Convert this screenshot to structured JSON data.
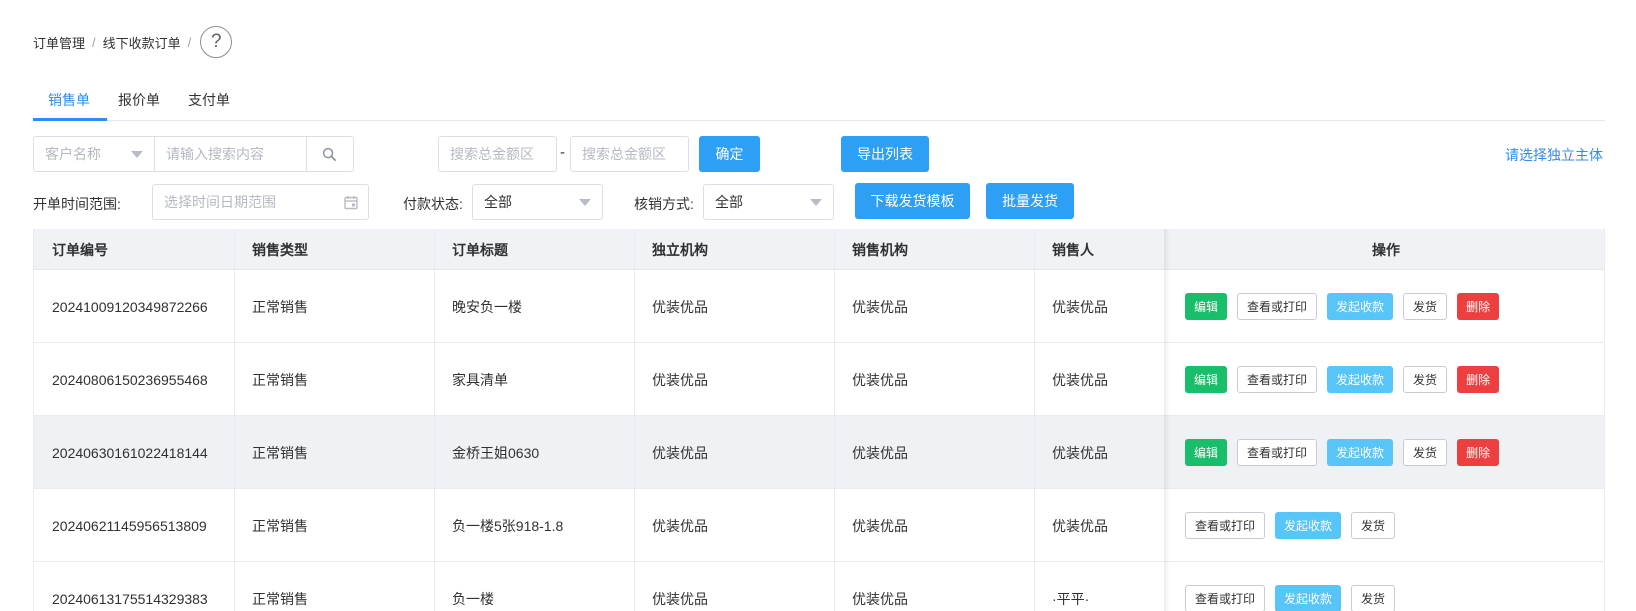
{
  "breadcrumb": {
    "item1": "订单管理",
    "sep": "/",
    "item2": "线下收款订单",
    "help": "?"
  },
  "tabs": [
    {
      "label": "销售单",
      "active": true
    },
    {
      "label": "报价单",
      "active": false
    },
    {
      "label": "支付单",
      "active": false
    }
  ],
  "filters": {
    "customer_select_placeholder": "客户名称",
    "search_placeholder": "请输入搜索内容",
    "amount_min_placeholder": "搜索总金额区",
    "amount_max_placeholder": "搜索总金额区",
    "amount_dash": "-",
    "confirm_label": "确定",
    "export_label": "导出列表",
    "select_entity_link": "请选择独立主体",
    "date_label": "开单时间范围:",
    "date_placeholder": "选择时间日期范围",
    "pay_status_label": "付款状态:",
    "pay_status_value": "全部",
    "writeoff_label": "核销方式:",
    "writeoff_value": "全部",
    "download_template_label": "下载发货模板",
    "batch_ship_label": "批量发货"
  },
  "table": {
    "headers": [
      "订单编号",
      "销售类型",
      "订单标题",
      "独立机构",
      "销售机构",
      "销售人",
      "操作"
    ],
    "rows": [
      {
        "id": "2024100912034987226‌6",
        "type": "正常销售",
        "title": "晚安负一楼",
        "org": "优装优品",
        "sales_org": "优装优品",
        "seller": "优装优品",
        "actions": [
          "编辑",
          "查看或打印",
          "发起收款",
          "发货",
          "删除"
        ]
      }
    ]
  },
  "rows": [
    {
      "id": "20241009120349872266",
      "type": "正常销售",
      "title": "晚安负一楼",
      "org": "优装优品",
      "sales_org": "优装优品",
      "seller": "优装优品"
    },
    {
      "id": "20240806150236955468",
      "type": "正常销售",
      "title": "家具清单",
      "org": "优装优品",
      "sales_org": "优装优品",
      "seller": "优装优品"
    },
    {
      "id": "20240630161022418144",
      "type": "正常销售",
      "title": "金桥王姐0630",
      "org": "优装优品",
      "sales_org": "优装优品",
      "seller": "优装优品"
    },
    {
      "id": "20240621145956513809",
      "type": "正常销售",
      "title": "负一楼5张918-1.8",
      "org": "优装优品",
      "sales_org": "优装优品",
      "seller": "优装优品"
    },
    {
      "id": "20240613175514329383",
      "type": "正常销售",
      "title": "负一楼",
      "org": "优装优品",
      "sales_org": "优装优品",
      "seller": "·平平·"
    }
  ],
  "actions": {
    "edit": "编辑",
    "view": "查看或打印",
    "collect": "发起收款",
    "ship": "发货",
    "delete": "删除"
  },
  "colors": {
    "primary": "#2d9ff5",
    "success": "#19be6b",
    "danger": "#ed3f3f",
    "info": "#57c5f7"
  },
  "icons": {
    "search": "search-icon",
    "calendar": "calendar-icon",
    "help": "help-icon"
  }
}
